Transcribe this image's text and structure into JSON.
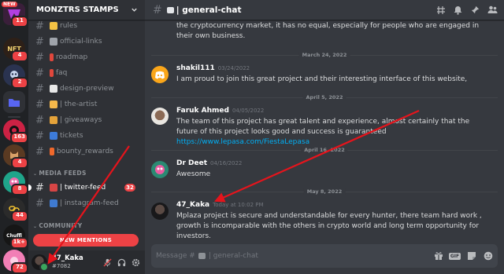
{
  "rail": {
    "top_label": "NEW",
    "badges": [
      "11",
      "4",
      "2",
      "163",
      "4",
      "8",
      "44",
      "1k+",
      "72"
    ],
    "logo_texts": [
      "NFT",
      "Chuffl"
    ]
  },
  "sidebar": {
    "server_name": "MONZTRS STAMPS",
    "channels": [
      {
        "label": "rules"
      },
      {
        "label": "official-links"
      },
      {
        "label": "roadmap"
      },
      {
        "label": "faq"
      },
      {
        "label": "design-preview"
      },
      {
        "label": "| the-artist"
      },
      {
        "label": "| giveaways"
      },
      {
        "label": "tickets"
      },
      {
        "label": "bounty_rewards"
      }
    ],
    "categories": {
      "media": "MEDIA FEEDS",
      "community": "COMMUNITY"
    },
    "media_channels": [
      {
        "label": "| twitter-feed",
        "count": "32"
      },
      {
        "label": "| instagram-feed"
      }
    ],
    "new_mentions": "NEW MENTIONS"
  },
  "user": {
    "name": "47_Kaka",
    "tag": "#7082"
  },
  "chat": {
    "channel": "| general-chat",
    "top_text": "the cryptocurrency market, it has no equal, especially for people who are engaged in their own business.",
    "messages": [
      {
        "date": "March 24, 2022",
        "author": "shakil111",
        "time": "03/24/2022",
        "text": "I am proud to join this great project and their interesting interface of this website,"
      },
      {
        "date": "April 5, 2022",
        "author": "Faruk Ahmed",
        "time": "04/05/2022",
        "text": "The team of this project has great talent and experience, almost certainly that the future of this project looks good and success is guaranteed ",
        "link": "https://www.lepasa.com/FiestaLepasa"
      },
      {
        "date": "April 16, 2022",
        "author": "Dr Deet",
        "time": "04/16/2022",
        "text": "Awesome"
      },
      {
        "date": "May 8, 2022",
        "author": "47_Kaka",
        "time": "Today at 10:02 PM",
        "text": "Mplaza project is secure and understandable for every hunter, there team hard work , growth is incomparable with the others in crypto world and long term opportunity for investors."
      }
    ],
    "composer_placeholder": "Message #",
    "composer_channel": "| general-chat",
    "gif_label": "GIF"
  },
  "colors": {
    "accent": "#5865f2",
    "red": "#ed4245",
    "green": "#3ba55d",
    "link": "#00aff4",
    "arrow": "#e5141c"
  },
  "icons": [
    "threads-icon",
    "bell-icon",
    "pin-icon",
    "members-icon",
    "gift-icon",
    "gif-icon",
    "sticker-icon",
    "emoji-icon",
    "mute-icon",
    "headphones-icon",
    "gear-icon"
  ]
}
